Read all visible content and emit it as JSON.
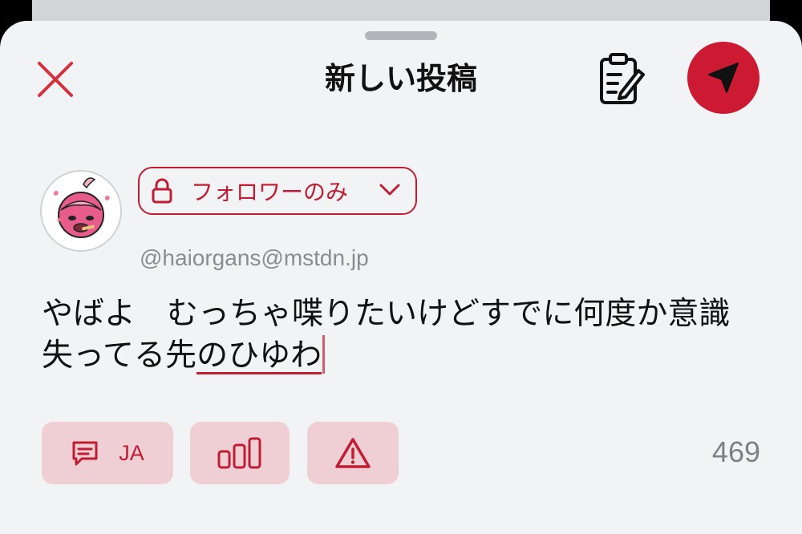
{
  "header": {
    "title": "新しい投稿",
    "close_icon": "close-icon",
    "drafts_icon": "clipboard-edit-icon",
    "send_icon": "send-icon"
  },
  "account": {
    "handle": "@haiorgans@mstdn.jp"
  },
  "visibility": {
    "label": "フォロワーのみ",
    "icon": "lock-icon"
  },
  "composer": {
    "line1": "やばよ　むっちゃ喋りたいけどすでに何度か意識",
    "line2_committed": "失ってる先",
    "line2_marked": "のひゆわ"
  },
  "toolbar": {
    "language_label": "JA",
    "language_icon": "speech-bubble-icon",
    "poll_icon": "poll-icon",
    "cw_icon": "warning-icon"
  },
  "char_counter": "469",
  "colors": {
    "accent": "#cb1a31",
    "button_tint": "#efcfd4",
    "sheet_bg": "#f1f3f5"
  }
}
